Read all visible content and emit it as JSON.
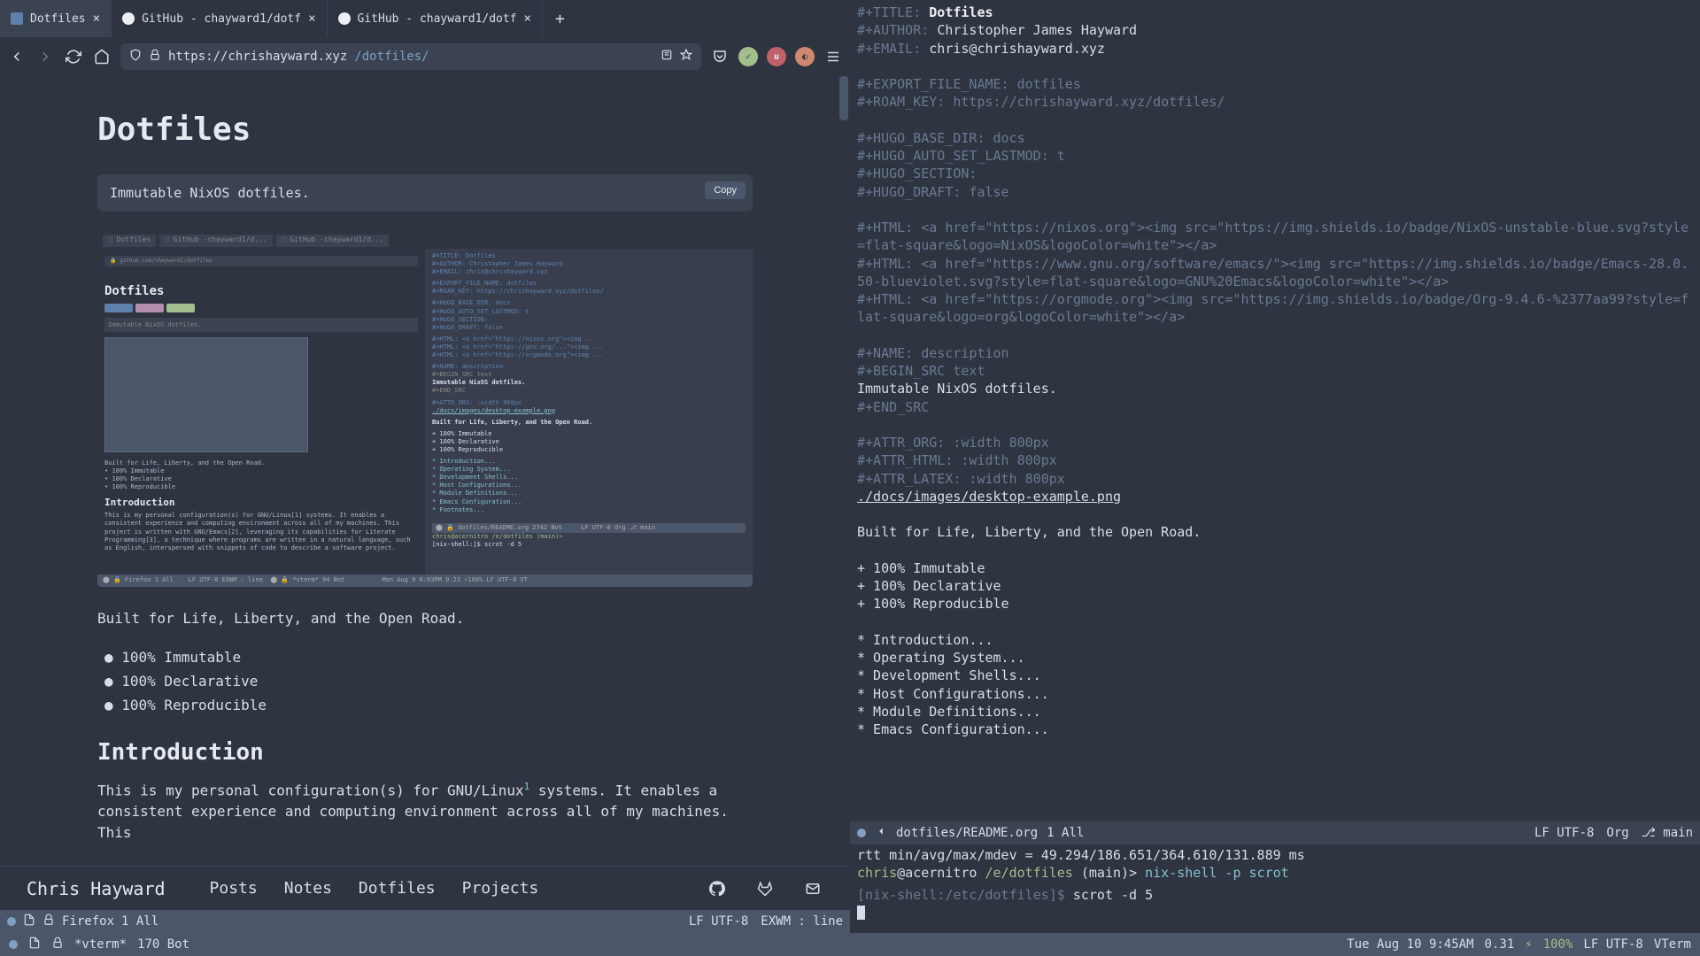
{
  "browser": {
    "tabs": [
      {
        "title": "Dotfiles",
        "active": true
      },
      {
        "title": "GitHub - chayward1/dotf",
        "active": false
      },
      {
        "title": "GitHub - chayward1/dotf",
        "active": false
      }
    ],
    "url_host": "https://chrishayward.xyz",
    "url_path": "/dotfiles/"
  },
  "page": {
    "h1": "Dotfiles",
    "codeblock": "Immutable NixOS dotfiles.",
    "copy_label": "Copy",
    "tagline": "Built for Life, Liberty, and the Open Road.",
    "bullets": [
      "100% Immutable",
      "100% Declarative",
      "100% Reproducible"
    ],
    "h2": "Introduction",
    "intro": "This is my personal configuration(s) for GNU/Linux",
    "intro2": " systems. It enables a consistent experience and computing environment across all of my machines. This"
  },
  "nested": {
    "h1": "Dotfiles",
    "codeblock": "Immutable NixOS dotfiles.",
    "tagline": "Built for Life, Liberty, and the Open Road.",
    "bullets": [
      "100% Immutable",
      "100% Declarative",
      "100% Reproducible"
    ],
    "h2": "Introduction",
    "intro": "This is my personal configuration(s) for GNU/Linux[1] systems. It enables a consistent experience and computing environment across all of my machines. This project is written with GNU/Emacs[2], leveraging its capabilities for Literate Programming[3], a technique where programs are written in a natural language, such as English, interspersed with snippets of code to describe a software project.",
    "right_title": "#+TITLE: Dotfiles",
    "right_body": "Built for Life, Liberty, and the Open Road."
  },
  "site_nav": {
    "brand": "Chris Hayward",
    "links": [
      "Posts",
      "Notes",
      "Dotfiles",
      "Projects"
    ]
  },
  "left_modeline": {
    "buffer": "Firefox",
    "pos": "1 All",
    "encoding": "LF UTF-8",
    "mode": "EXWM : line"
  },
  "editor": {
    "lines": [
      {
        "kw": "#+TITLE: ",
        "val": "Dotfiles",
        "cls": "org-title"
      },
      {
        "kw": "#+AUTHOR: ",
        "val": "Christopher James Hayward",
        "cls": "org-val"
      },
      {
        "kw": "#+EMAIL: ",
        "val": "chris@chrishayward.xyz",
        "cls": "org-val"
      },
      {
        "blank": true
      },
      {
        "kw": "#+EXPORT_FILE_NAME: dotfiles"
      },
      {
        "kw": "#+ROAM_KEY: https://chrishayward.xyz/dotfiles/"
      },
      {
        "blank": true
      },
      {
        "kw": "#+HUGO_BASE_DIR: docs"
      },
      {
        "kw": "#+HUGO_AUTO_SET_LASTMOD: t"
      },
      {
        "kw": "#+HUGO_SECTION:"
      },
      {
        "kw": "#+HUGO_DRAFT: false"
      },
      {
        "blank": true
      },
      {
        "kw": "#+HTML: <a href=\"https://nixos.org\"><img src=\"https://img.shields.io/badge/NixOS-unstable-blue.svg?style=flat-square&logo=NixOS&logoColor=white\"></a>"
      },
      {
        "kw": "#+HTML: <a href=\"https://www.gnu.org/software/emacs/\"><img src=\"https://img.shields.io/badge/Emacs-28.0.50-blueviolet.svg?style=flat-square&logo=GNU%20Emacs&logoColor=white\"></a>"
      },
      {
        "kw": "#+HTML: <a href=\"https://orgmode.org\"><img src=\"https://img.shields.io/badge/Org-9.4.6-%2377aa99?style=flat-square&logo=org&logoColor=white\"></a>"
      },
      {
        "blank": true
      },
      {
        "kw": "#+NAME: description"
      },
      {
        "src": "#+BEGIN_SRC text"
      },
      {
        "body": "Immutable NixOS dotfiles."
      },
      {
        "src": "#+END_SRC"
      },
      {
        "blank": true
      },
      {
        "kw": "#+ATTR_ORG: :width 800px"
      },
      {
        "kw": "#+ATTR_HTML: :width 800px"
      },
      {
        "kw": "#+ATTR_LATEX: :width 800px"
      },
      {
        "link": "./docs/images/desktop-example.png"
      },
      {
        "blank": true
      },
      {
        "body": "Built for Life, Liberty, and the Open Road."
      },
      {
        "blank": true
      },
      {
        "body": "+ 100% Immutable"
      },
      {
        "body": "+ 100% Declarative"
      },
      {
        "body": "+ 100% Reproducible"
      },
      {
        "blank": true
      },
      {
        "head": "* Introduction..."
      },
      {
        "head": "* Operating System..."
      },
      {
        "head": "* Development Shells..."
      },
      {
        "head": "* Host Configurations..."
      },
      {
        "head": "* Module Definitions..."
      },
      {
        "head": "* Emacs Configuration..."
      }
    ]
  },
  "editor_modeline": {
    "buffer": "dotfiles/README.org",
    "pos": "1 All",
    "encoding": "LF UTF-8",
    "mode": "Org",
    "branch": "main"
  },
  "terminal": {
    "line1": "rtt min/avg/max/mdev = 49.294/186.651/364.610/131.889 ms",
    "prompt_user": "chris",
    "prompt_at": "@acernitro",
    "prompt_path": "/e/dotfiles",
    "prompt_branch": "(main)",
    "prompt_arrow": ">",
    "cmd1": "nix-shell -p scrot",
    "nix_prompt": "[nix-shell:/etc/dotfiles]$",
    "cmd2": "scrot -d 5"
  },
  "term_modeline": {
    "buffer": "*vterm*",
    "pos": "170 Bot"
  },
  "desktop": {
    "datetime": "Tue Aug 10 9:45AM",
    "load": "0.31",
    "battery": "100%",
    "encoding": "LF UTF-8",
    "mode": "VTerm"
  }
}
